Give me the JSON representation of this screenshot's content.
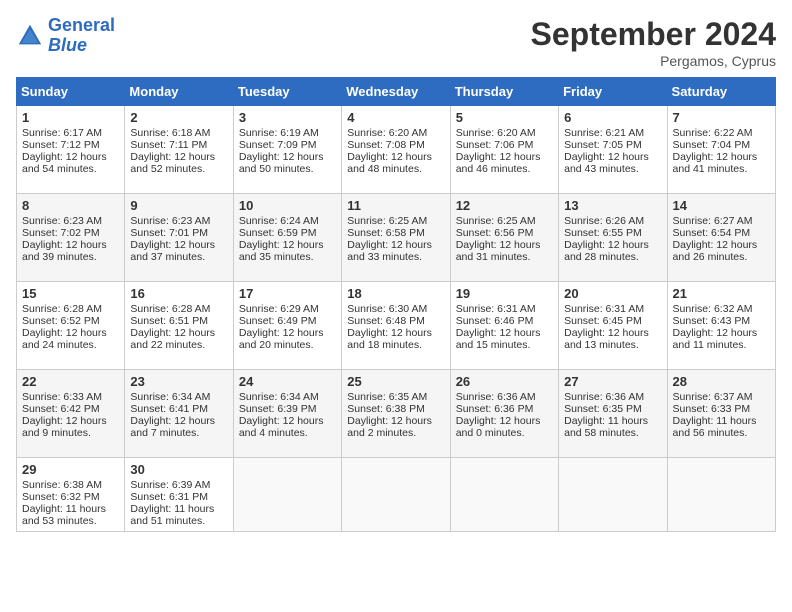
{
  "header": {
    "logo_line1": "General",
    "logo_line2": "Blue",
    "month_year": "September 2024",
    "location": "Pergamos, Cyprus"
  },
  "days_of_week": [
    "Sunday",
    "Monday",
    "Tuesday",
    "Wednesday",
    "Thursday",
    "Friday",
    "Saturday"
  ],
  "weeks": [
    [
      {
        "day": "1",
        "lines": [
          "Sunrise: 6:17 AM",
          "Sunset: 7:12 PM",
          "Daylight: 12 hours",
          "and 54 minutes."
        ]
      },
      {
        "day": "2",
        "lines": [
          "Sunrise: 6:18 AM",
          "Sunset: 7:11 PM",
          "Daylight: 12 hours",
          "and 52 minutes."
        ]
      },
      {
        "day": "3",
        "lines": [
          "Sunrise: 6:19 AM",
          "Sunset: 7:09 PM",
          "Daylight: 12 hours",
          "and 50 minutes."
        ]
      },
      {
        "day": "4",
        "lines": [
          "Sunrise: 6:20 AM",
          "Sunset: 7:08 PM",
          "Daylight: 12 hours",
          "and 48 minutes."
        ]
      },
      {
        "day": "5",
        "lines": [
          "Sunrise: 6:20 AM",
          "Sunset: 7:06 PM",
          "Daylight: 12 hours",
          "and 46 minutes."
        ]
      },
      {
        "day": "6",
        "lines": [
          "Sunrise: 6:21 AM",
          "Sunset: 7:05 PM",
          "Daylight: 12 hours",
          "and 43 minutes."
        ]
      },
      {
        "day": "7",
        "lines": [
          "Sunrise: 6:22 AM",
          "Sunset: 7:04 PM",
          "Daylight: 12 hours",
          "and 41 minutes."
        ]
      }
    ],
    [
      {
        "day": "8",
        "lines": [
          "Sunrise: 6:23 AM",
          "Sunset: 7:02 PM",
          "Daylight: 12 hours",
          "and 39 minutes."
        ]
      },
      {
        "day": "9",
        "lines": [
          "Sunrise: 6:23 AM",
          "Sunset: 7:01 PM",
          "Daylight: 12 hours",
          "and 37 minutes."
        ]
      },
      {
        "day": "10",
        "lines": [
          "Sunrise: 6:24 AM",
          "Sunset: 6:59 PM",
          "Daylight: 12 hours",
          "and 35 minutes."
        ]
      },
      {
        "day": "11",
        "lines": [
          "Sunrise: 6:25 AM",
          "Sunset: 6:58 PM",
          "Daylight: 12 hours",
          "and 33 minutes."
        ]
      },
      {
        "day": "12",
        "lines": [
          "Sunrise: 6:25 AM",
          "Sunset: 6:56 PM",
          "Daylight: 12 hours",
          "and 31 minutes."
        ]
      },
      {
        "day": "13",
        "lines": [
          "Sunrise: 6:26 AM",
          "Sunset: 6:55 PM",
          "Daylight: 12 hours",
          "and 28 minutes."
        ]
      },
      {
        "day": "14",
        "lines": [
          "Sunrise: 6:27 AM",
          "Sunset: 6:54 PM",
          "Daylight: 12 hours",
          "and 26 minutes."
        ]
      }
    ],
    [
      {
        "day": "15",
        "lines": [
          "Sunrise: 6:28 AM",
          "Sunset: 6:52 PM",
          "Daylight: 12 hours",
          "and 24 minutes."
        ]
      },
      {
        "day": "16",
        "lines": [
          "Sunrise: 6:28 AM",
          "Sunset: 6:51 PM",
          "Daylight: 12 hours",
          "and 22 minutes."
        ]
      },
      {
        "day": "17",
        "lines": [
          "Sunrise: 6:29 AM",
          "Sunset: 6:49 PM",
          "Daylight: 12 hours",
          "and 20 minutes."
        ]
      },
      {
        "day": "18",
        "lines": [
          "Sunrise: 6:30 AM",
          "Sunset: 6:48 PM",
          "Daylight: 12 hours",
          "and 18 minutes."
        ]
      },
      {
        "day": "19",
        "lines": [
          "Sunrise: 6:31 AM",
          "Sunset: 6:46 PM",
          "Daylight: 12 hours",
          "and 15 minutes."
        ]
      },
      {
        "day": "20",
        "lines": [
          "Sunrise: 6:31 AM",
          "Sunset: 6:45 PM",
          "Daylight: 12 hours",
          "and 13 minutes."
        ]
      },
      {
        "day": "21",
        "lines": [
          "Sunrise: 6:32 AM",
          "Sunset: 6:43 PM",
          "Daylight: 12 hours",
          "and 11 minutes."
        ]
      }
    ],
    [
      {
        "day": "22",
        "lines": [
          "Sunrise: 6:33 AM",
          "Sunset: 6:42 PM",
          "Daylight: 12 hours",
          "and 9 minutes."
        ]
      },
      {
        "day": "23",
        "lines": [
          "Sunrise: 6:34 AM",
          "Sunset: 6:41 PM",
          "Daylight: 12 hours",
          "and 7 minutes."
        ]
      },
      {
        "day": "24",
        "lines": [
          "Sunrise: 6:34 AM",
          "Sunset: 6:39 PM",
          "Daylight: 12 hours",
          "and 4 minutes."
        ]
      },
      {
        "day": "25",
        "lines": [
          "Sunrise: 6:35 AM",
          "Sunset: 6:38 PM",
          "Daylight: 12 hours",
          "and 2 minutes."
        ]
      },
      {
        "day": "26",
        "lines": [
          "Sunrise: 6:36 AM",
          "Sunset: 6:36 PM",
          "Daylight: 12 hours",
          "and 0 minutes."
        ]
      },
      {
        "day": "27",
        "lines": [
          "Sunrise: 6:36 AM",
          "Sunset: 6:35 PM",
          "Daylight: 11 hours",
          "and 58 minutes."
        ]
      },
      {
        "day": "28",
        "lines": [
          "Sunrise: 6:37 AM",
          "Sunset: 6:33 PM",
          "Daylight: 11 hours",
          "and 56 minutes."
        ]
      }
    ],
    [
      {
        "day": "29",
        "lines": [
          "Sunrise: 6:38 AM",
          "Sunset: 6:32 PM",
          "Daylight: 11 hours",
          "and 53 minutes."
        ]
      },
      {
        "day": "30",
        "lines": [
          "Sunrise: 6:39 AM",
          "Sunset: 6:31 PM",
          "Daylight: 11 hours",
          "and 51 minutes."
        ]
      },
      {
        "day": "",
        "lines": []
      },
      {
        "day": "",
        "lines": []
      },
      {
        "day": "",
        "lines": []
      },
      {
        "day": "",
        "lines": []
      },
      {
        "day": "",
        "lines": []
      }
    ]
  ]
}
